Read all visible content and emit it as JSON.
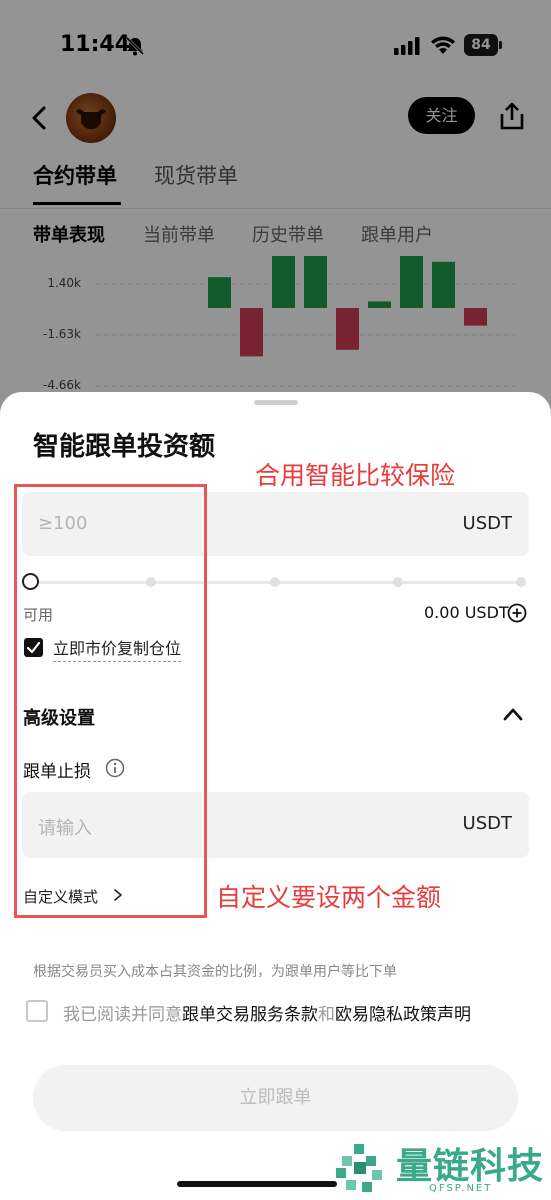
{
  "status_bar": {
    "time": "11:44",
    "battery": "84"
  },
  "header": {
    "follow_label": "关注"
  },
  "tabs": {
    "main": [
      "合约带单",
      "现货带单"
    ],
    "sub": [
      "带单表现",
      "当前带单",
      "历史带单",
      "跟单用户"
    ]
  },
  "chart_data": {
    "type": "bar",
    "ytick_labels": [
      "1.40k",
      "-1.63k",
      "-4.66k"
    ],
    "values": [
      1.4,
      -2.2,
      2.5,
      2.5,
      -1.9,
      0.3,
      2.5,
      2.1,
      -0.8
    ],
    "colors": {
      "positive": "#1f9e4a",
      "negative": "#d03b55"
    }
  },
  "sheet": {
    "title": "智能跟单投资额",
    "amount_placeholder": "≥100",
    "amount_unit": "USDT",
    "available_label": "可用",
    "available_value": "0.00 USDT",
    "copy_positions_label": "立即市价复制仓位",
    "advanced_settings": "高级设置",
    "stop_loss_label": "跟单止损",
    "stop_loss_placeholder": "请输入",
    "stop_loss_unit": "USDT",
    "custom_mode": "自定义模式",
    "description": "根据交易员买入成本占其资金的比例，为跟单用户等比下单",
    "agree_prefix": "我已阅读并同意",
    "terms_link": "跟单交易服务条款",
    "agree_and": "和",
    "privacy_link": "欧易隐私政策声明",
    "submit_label": "立即跟单"
  },
  "annotations": {
    "top": "合用智能比较保险",
    "bottom": "自定义要设两个金额"
  },
  "watermark": {
    "text": "量链科技",
    "sub": "QFSP.NET"
  }
}
